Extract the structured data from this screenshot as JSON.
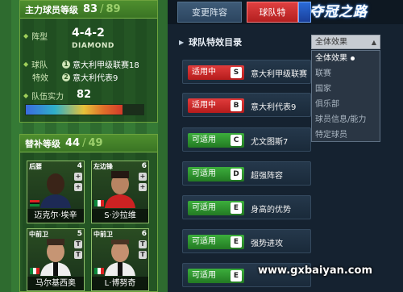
{
  "lineup": {
    "title": "主力球员等级",
    "level": "83",
    "max_level": "89",
    "formation_label": "阵型",
    "formation": "4-4-2",
    "formation_style": "DIAMOND",
    "chem_label_1": "球队",
    "chem_label_2": "特效",
    "chem_items": [
      {
        "index": "1",
        "text": "意大利甲级联赛18"
      },
      {
        "index": "2",
        "text": "意大利代表9"
      }
    ],
    "power_label": "队伍实力",
    "power_value": "82",
    "power_fraction": 0.82
  },
  "bench": {
    "title": "替补等级",
    "level": "44",
    "max_level": "49",
    "cards": [
      {
        "pos": "后腰",
        "rating": "4",
        "name": "迈克尔·埃辛",
        "tags": [
          "+",
          "+"
        ]
      },
      {
        "pos": "左边锋",
        "rating": "6",
        "name": "S·沙拉维",
        "tags": [
          "+",
          "+"
        ]
      },
      {
        "pos": "中前卫",
        "rating": "5",
        "name": "马尔基西奥",
        "tags": [
          "T",
          "T"
        ]
      },
      {
        "pos": "中前卫",
        "rating": "6",
        "name": "L·博努奇",
        "tags": [
          "T",
          "T"
        ]
      }
    ]
  },
  "tabs": {
    "tab1": "变更阵容",
    "tab2": "球队特"
  },
  "logo": "夺冠之路",
  "section_title": "球队特效目录",
  "filter": {
    "selected": "全体效果",
    "options": [
      "全体效果",
      "联赛",
      "国家",
      "俱乐部",
      "球员信息/能力",
      "特定球员"
    ]
  },
  "effects": [
    {
      "status": "适用中",
      "type": "active",
      "letter": "S",
      "name": "意大利甲级联赛"
    },
    {
      "status": "适用中",
      "type": "active",
      "letter": "B",
      "name": "意大利代表9"
    },
    {
      "status": "可适用",
      "type": "avail",
      "letter": "C",
      "name": "尤文图斯7"
    },
    {
      "status": "可适用",
      "type": "avail",
      "letter": "D",
      "name": "超强阵容"
    },
    {
      "status": "可适用",
      "type": "avail",
      "letter": "E",
      "name": "身高的优势"
    },
    {
      "status": "可适用",
      "type": "avail",
      "letter": "E",
      "name": "强势进攻"
    },
    {
      "status": "可适用",
      "type": "avail",
      "letter": "E",
      "name": ""
    }
  ],
  "watermark": "www.gxbaiyan.com",
  "colors": {
    "pitch_green": "#357a35",
    "active_red": "#e13c3c",
    "avail_green": "#3cae3c",
    "panel_dark": "#152230"
  }
}
